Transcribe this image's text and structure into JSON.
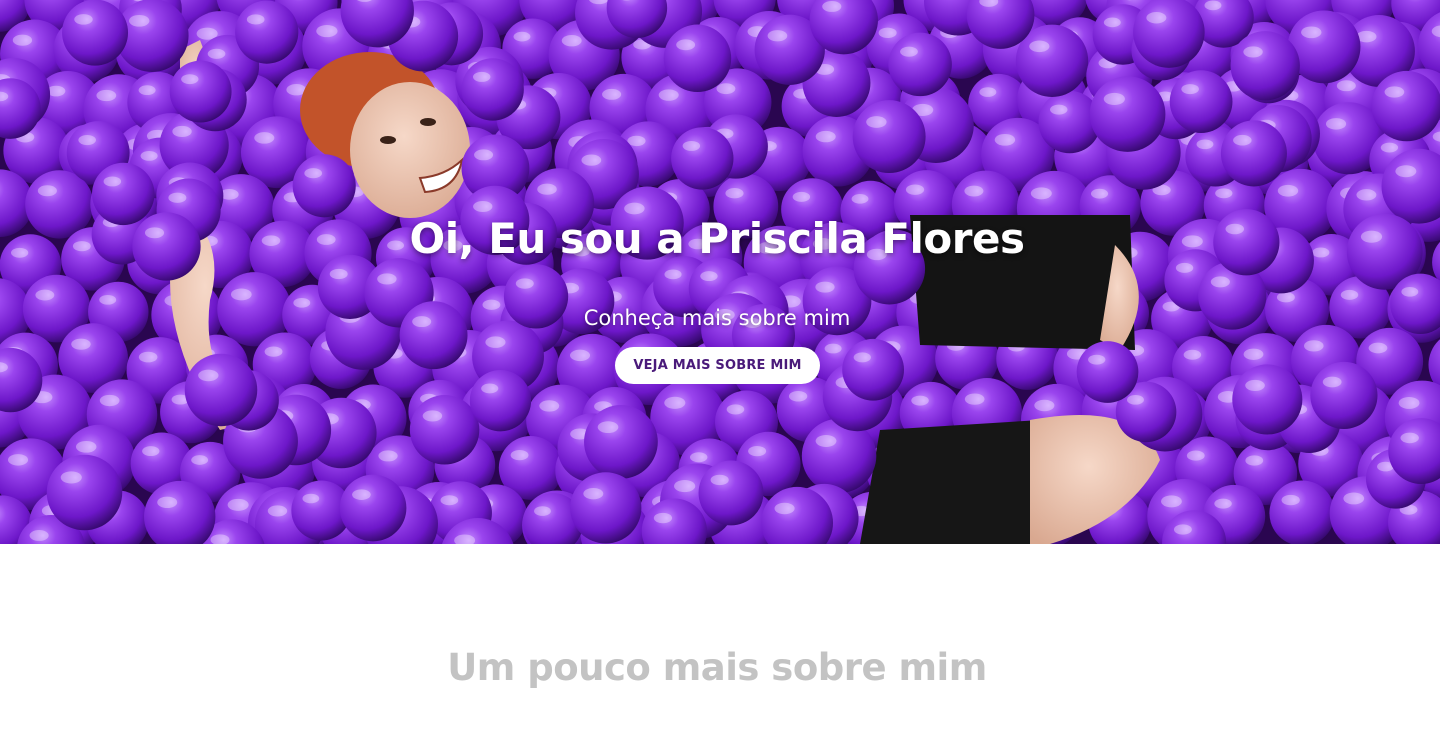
{
  "hero": {
    "title": "Oi, Eu sou a Priscila Flores",
    "subtitle": "Conheça mais sobre mim",
    "button_label": "VEJA MAIS SOBRE MIM",
    "background_image": "woman-in-purple-ball-pit",
    "colors": {
      "ball": "#7b22d6",
      "button_text": "#4a1a7a"
    }
  },
  "about": {
    "heading": "Um pouco mais sobre mim"
  }
}
